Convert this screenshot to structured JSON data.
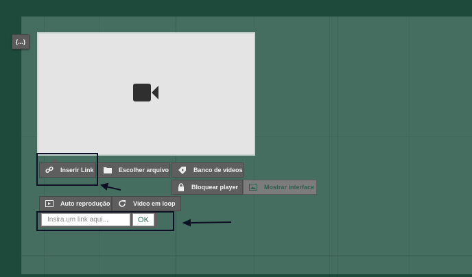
{
  "editor": {
    "code_button_label": "{...}"
  },
  "player": {
    "placeholder_icon": "video-camera-icon"
  },
  "toolbar": {
    "insert_link": "Inserir Link",
    "choose_file": "Escolher arquivo",
    "video_bank": "Banco de vídeos",
    "lock_player": "Bloquear player",
    "show_interface": "Mostrar interface",
    "autoplay": "Auto reprodução",
    "loop": "Vídeo em loop"
  },
  "link_form": {
    "placeholder": "Insira um link aqui...",
    "value": "",
    "ok_label": "OK"
  },
  "colors": {
    "page_background": "#1e4a3c",
    "canvas_background": "#466e60",
    "toolbar_button": "#5e5e5e",
    "toolbar_button_active": "#7c7c7c",
    "highlight_annotation": "#0e1024"
  }
}
